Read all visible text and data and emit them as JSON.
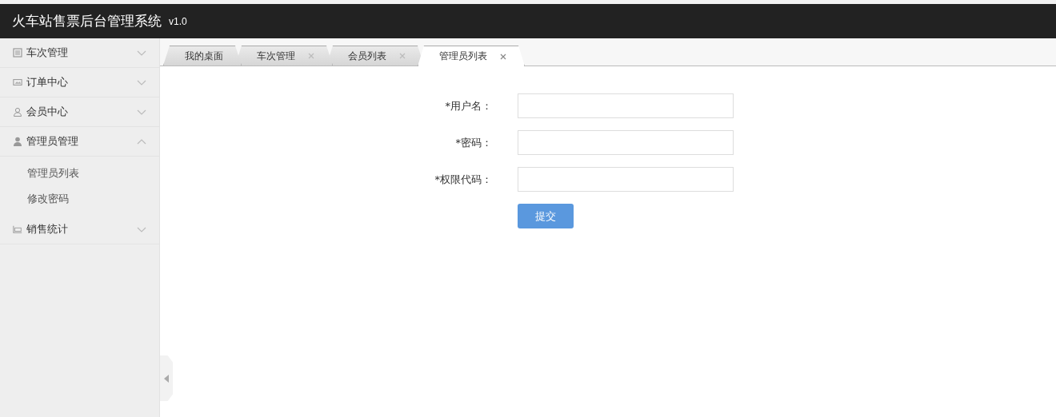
{
  "header": {
    "title": "火车站售票后台管理系统",
    "version": "v1.0"
  },
  "sidebar": {
    "items": [
      {
        "label": "车次管理",
        "expanded": false
      },
      {
        "label": "订单中心",
        "expanded": false
      },
      {
        "label": "会员中心",
        "expanded": false
      },
      {
        "label": "管理员管理",
        "expanded": true,
        "children": [
          {
            "label": "管理员列表"
          },
          {
            "label": "修改密码"
          }
        ]
      },
      {
        "label": "销售统计",
        "expanded": false
      }
    ]
  },
  "tabs": [
    {
      "label": "我的桌面",
      "closable": false,
      "selected": false
    },
    {
      "label": "车次管理",
      "closable": true,
      "selected": false
    },
    {
      "label": "会员列表",
      "closable": true,
      "selected": false
    },
    {
      "label": "管理员列表",
      "closable": true,
      "selected": true
    }
  ],
  "form": {
    "fields": [
      {
        "label": "*用户名："
      },
      {
        "label": "*密码："
      },
      {
        "label": "*权限代码："
      }
    ],
    "submit": "提交"
  }
}
